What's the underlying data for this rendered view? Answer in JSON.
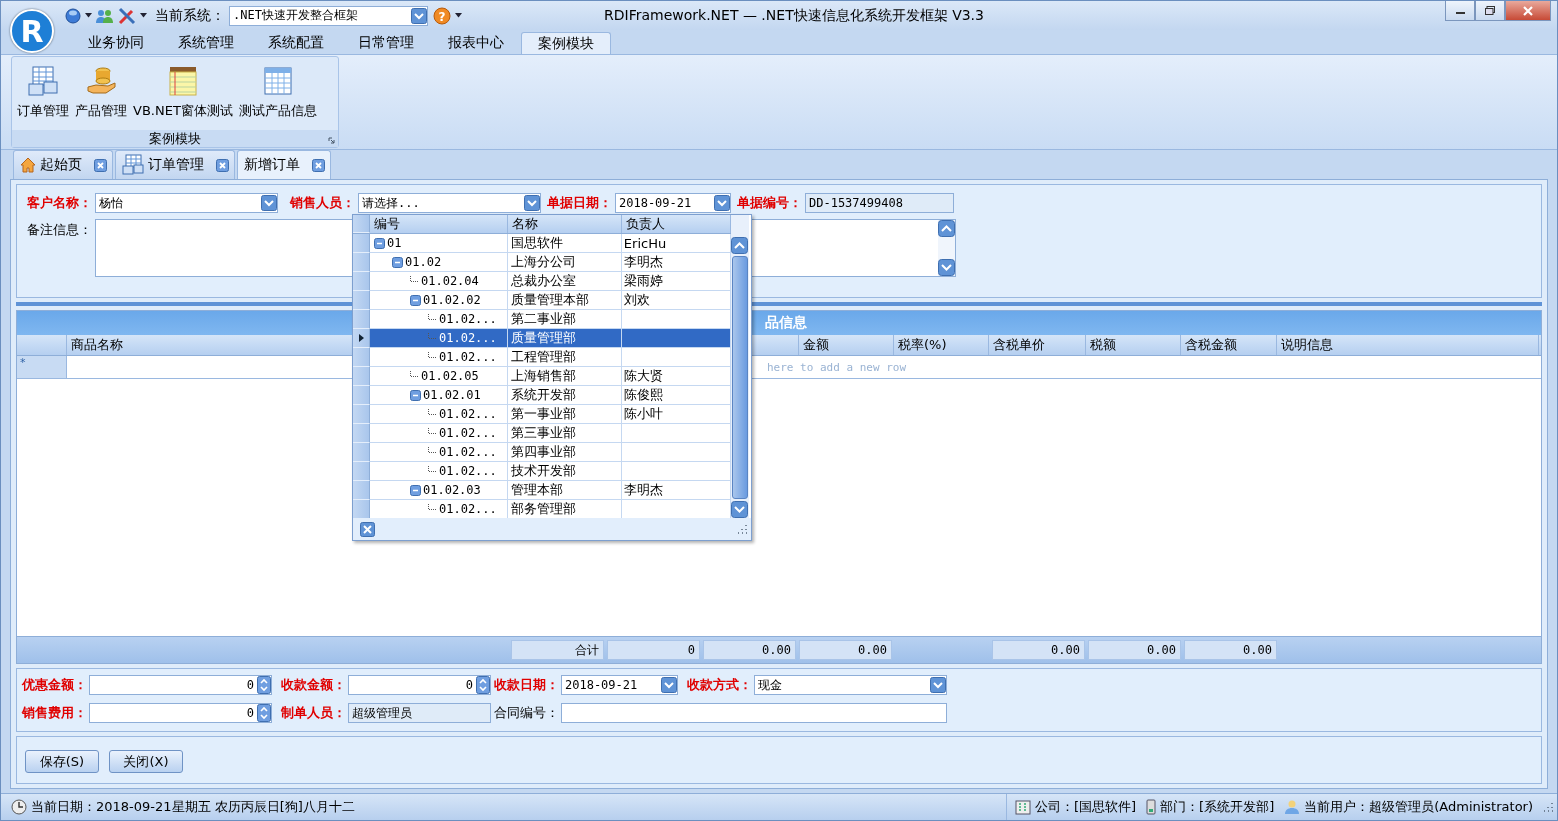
{
  "window": {
    "title": "RDIFramework.NET — .NET快速信息化系统开发框架 V3.3",
    "logo": "R"
  },
  "quick_access": {
    "system_label": "当前系统：",
    "system_value": ".NET快速开发整合框架",
    "help": "?"
  },
  "ribbon": {
    "tabs": [
      {
        "label": "业务协同",
        "selected": false
      },
      {
        "label": "系统管理",
        "selected": false
      },
      {
        "label": "系统配置",
        "selected": false
      },
      {
        "label": "日常管理",
        "selected": false
      },
      {
        "label": "报表中心",
        "selected": false
      },
      {
        "label": "案例模块",
        "selected": true
      }
    ],
    "group": {
      "label": "案例模块",
      "buttons": [
        {
          "label": "订单管理",
          "kind": "forms"
        },
        {
          "label": "产品管理",
          "kind": "coins"
        },
        {
          "label": "VB.NET窗体测试",
          "kind": "notepad"
        },
        {
          "label": "测试产品信息",
          "kind": "table"
        }
      ]
    }
  },
  "doc_tabs": [
    {
      "label": "起始页",
      "kind": "home",
      "selected": false
    },
    {
      "label": "订单管理",
      "kind": "forms",
      "selected": false
    },
    {
      "label": "新增订单",
      "kind": "plain",
      "selected": true
    }
  ],
  "form": {
    "fields": [
      {
        "label": "客户名称：",
        "required": true,
        "kind": "combo",
        "value": "杨怡"
      },
      {
        "label": "销售人员：",
        "required": true,
        "kind": "combo",
        "value": "请选择..."
      },
      {
        "label": "单据日期：",
        "required": true,
        "kind": "date",
        "value": "2018-09-21"
      },
      {
        "label": "单据编号：",
        "required": true,
        "kind": "readonly",
        "value": "DD-1537499408"
      }
    ],
    "remark": {
      "label": "备注信息：",
      "required": false
    }
  },
  "dropdown": {
    "columns": [
      "编号",
      "名称",
      "负责人"
    ],
    "rows": [
      {
        "code": "01",
        "name": "国思软件",
        "owner": "EricHu",
        "selected": false,
        "expanded": true,
        "children": [
          {
            "code": "01.02",
            "name": "上海分公司",
            "owner": "李明杰",
            "selected": false,
            "expanded": true,
            "children": [
              {
                "code": "01.02.04",
                "name": "总裁办公室",
                "owner": "梁雨婷",
                "selected": false
              },
              {
                "code": "01.02.02",
                "name": "质量管理本部",
                "owner": "刘欢",
                "selected": false,
                "expanded": true,
                "children": [
                  {
                    "code": "01.02...",
                    "name": "第二事业部",
                    "selected": false
                  },
                  {
                    "code": "01.02...",
                    "name": "质量管理部",
                    "selected": true
                  },
                  {
                    "code": "01.02...",
                    "name": "工程管理部",
                    "selected": false
                  }
                ]
              },
              {
                "code": "01.02.05",
                "name": "上海销售部",
                "owner": "陈大贤",
                "selected": false
              },
              {
                "code": "01.02.01",
                "name": "系统开发部",
                "owner": "陈俊熙",
                "selected": false,
                "expanded": true,
                "children": [
                  {
                    "code": "01.02...",
                    "name": "第一事业部",
                    "owner": "陈小叶",
                    "selected": false
                  },
                  {
                    "code": "01.02...",
                    "name": "第三事业部",
                    "selected": false
                  },
                  {
                    "code": "01.02...",
                    "name": "第四事业部",
                    "selected": false
                  },
                  {
                    "code": "01.02...",
                    "name": "技术开发部",
                    "selected": false
                  }
                ]
              },
              {
                "code": "01.02.03",
                "name": "管理本部",
                "owner": "李明杰",
                "selected": false,
                "expanded": true,
                "children": [
                  {
                    "code": "01.02...",
                    "name": "部务管理部",
                    "selected": false
                  }
                ]
              }
            ]
          }
        ]
      }
    ]
  },
  "grid": {
    "title": "品信息",
    "columns": [
      "商品名称",
      "金额",
      "税率(%)",
      "含税单价",
      "税额",
      "含税金额",
      "说明信息"
    ],
    "new_row_hint": "here to add a new row",
    "new_row_mark": "*",
    "totals": [
      "合计",
      "0",
      "0.00",
      "0.00",
      "0.00",
      "0.00",
      "0.00"
    ]
  },
  "payment": {
    "rows": [
      [
        {
          "label": "优惠金额：",
          "required": true,
          "kind": "spin",
          "value": "0"
        },
        {
          "label": "收款金额：",
          "required": true,
          "kind": "spin",
          "value": "0"
        },
        {
          "label": "收款日期：",
          "required": true,
          "kind": "date",
          "value": "2018-09-21"
        },
        {
          "label": "收款方式：",
          "required": true,
          "kind": "combo",
          "value": "现金"
        }
      ],
      [
        {
          "label": "销售费用：",
          "required": true,
          "kind": "spin",
          "value": "0"
        },
        {
          "label": "制单人员：",
          "required": true,
          "kind": "readonly",
          "value": "超级管理员"
        },
        {
          "label": "合同编号：",
          "required": false,
          "kind": "text"
        }
      ]
    ]
  },
  "buttons": [
    "保存(S)",
    "关闭(X)"
  ],
  "status_bar": {
    "date": "当前日期：2018-09-21星期五 农历丙辰日[狗]八月十二",
    "company": "公司：[国思软件]",
    "department": "部门：[系统开发部]",
    "user": "当前用户：超级管理员(Administrator)"
  }
}
